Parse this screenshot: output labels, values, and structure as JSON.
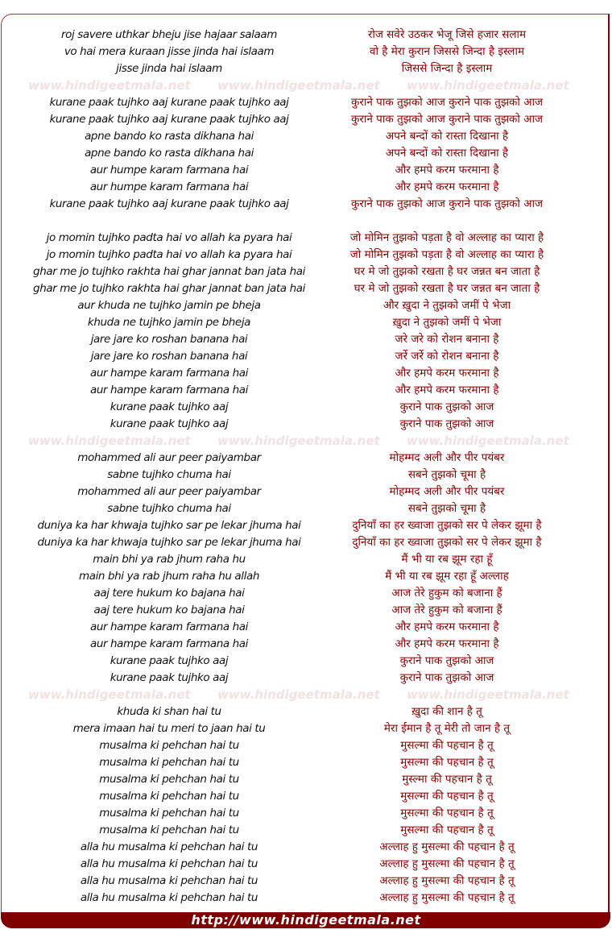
{
  "watermark": "www.hindigeetmala.net",
  "footer_link": "http://www.hindigeetmala.net",
  "colors": {
    "accent": "#800000",
    "hindi_text": "#8b0000",
    "watermark": "#f1e1e1"
  },
  "rows": [
    {
      "en": "roj savere uthkar bheju jise hajaar salaam",
      "hi": "रोज सवेरे उठकर भेजू जिसे हजार सलाम"
    },
    {
      "en": "vo hai mera kuraan jisse jinda hai islaam",
      "hi": "वो है मेरा कुरान जिससे जिन्दा है इस्लाम"
    },
    {
      "en": "jisse jinda hai islaam",
      "hi": "जिससे जिन्दा है इस्लाम"
    },
    {
      "wm": true
    },
    {
      "en": "kurane paak tujhko aaj kurane paak tujhko aaj",
      "hi": "कुराने पाक तुझको आज कुराने पाक तुझको आज"
    },
    {
      "en": "kurane paak tujhko aaj kurane paak tujhko aaj",
      "hi": "कुराने पाक तुझको आज कुराने पाक तुझको आज"
    },
    {
      "en": "apne bando ko rasta dikhana hai",
      "hi": "अपने बन्दों को रास्ता दिखाना है"
    },
    {
      "en": "apne bando ko rasta dikhana hai",
      "hi": "अपने बन्दों को रास्ता दिखाना है"
    },
    {
      "en": "aur humpe karam farmana hai",
      "hi": "और हमपे करम फरमाना है"
    },
    {
      "en": "aur humpe karam farmana hai",
      "hi": "और हमपे करम फरमाना है"
    },
    {
      "en": "kurane paak tujhko aaj kurane paak tujhko aaj",
      "hi": "कुराने पाक तुझको आज कुराने पाक तुझको आज"
    },
    {
      "blank": true
    },
    {
      "en": "jo momin tujhko padta hai vo allah ka pyara hai",
      "hi": "जो मोमिन तुझको पड़ता है वो अल्लाह का प्यारा है"
    },
    {
      "en": "jo momin tujhko padta hai vo allah ka pyara hai",
      "hi": "जो मोमिन तुझको पड़ता है वो अल्लाह का प्यारा है"
    },
    {
      "en": "ghar me jo tujhko rakhta hai ghar jannat ban jata hai",
      "hi": "घर मे जो तुझको रखता है घर जन्नत बन जाता है"
    },
    {
      "en": "ghar me jo tujhko rakhta hai ghar jannat ban jata hai",
      "hi": "घर मे जो तुझको रखता है घर जन्नत बन जाता है"
    },
    {
      "en": "aur khuda ne tujhko jamin pe bheja",
      "hi": "और ख़ुदा ने तुझको जमीं पे भेजा"
    },
    {
      "en": "khuda ne tujhko jamin pe bheja",
      "hi": "ख़ुदा ने तुझको जमीं पे भेजा"
    },
    {
      "en": "jare jare ko roshan banana hai",
      "hi": "जरे जरे को रोशन बनाना है"
    },
    {
      "en": "jare jare ko roshan banana hai",
      "hi": "जर्रे जर्रे को रोशन बनाना है"
    },
    {
      "en": "aur hampe karam farmana hai",
      "hi": "और हमपे करम फरमाना है"
    },
    {
      "en": "aur hampe karam farmana hai",
      "hi": "और हमपे करम फरमाना है"
    },
    {
      "en": "kurane paak tujhko aaj",
      "hi": "कुराने पाक तुझको आज"
    },
    {
      "en": "kurane paak tujhko aaj",
      "hi": "कुराने पाक तुझको आज"
    },
    {
      "wm": true
    },
    {
      "en": "mohammed ali aur peer paiyambar",
      "hi": "मोहम्मद अली और पीर पयंबर"
    },
    {
      "en": "sabne tujhko chuma hai",
      "hi": "सबने तुझको चूमा है"
    },
    {
      "en": "mohammed ali aur peer paiyambar",
      "hi": "मोहम्मद अली और पीर पयंबर"
    },
    {
      "en": "sabne tujhko chuma hai",
      "hi": "सबने तुझको चूमा है"
    },
    {
      "en": "duniya ka har khwaja tujhko sar pe lekar jhuma hai",
      "hi": "दुनियाँ का हर ख्वाजा तुझको सर पे लेकर झूमा है"
    },
    {
      "en": "duniya ka har khwaja tujhko sar pe lekar jhuma hai",
      "hi": "दुनियाँ का हर ख्वाजा तुझको सर पे लेकर झूमा है"
    },
    {
      "en": "main bhi ya rab jhum raha hu",
      "hi": "मैं भी या रब झूम रहा हूँ"
    },
    {
      "en": "main bhi ya rab jhum raha hu allah",
      "hi": "मैं भी या रब झूम रहा हूँ अल्लाह"
    },
    {
      "en": "aaj tere hukum ko bajana hai",
      "hi": "आज तेरे हुकुम को बजाना हैं"
    },
    {
      "en": "aaj tere hukum ko bajana hai",
      "hi": "आज तेरे हुकुम को बजाना हैं"
    },
    {
      "en": "aur hampe karam farmana hai",
      "hi": "और हमपे करम फरमाना है"
    },
    {
      "en": "aur hampe karam farmana hai",
      "hi": "और हमपे करम फरमाना है"
    },
    {
      "en": "kurane paak tujhko aaj",
      "hi": "कुराने पाक तुझको आज"
    },
    {
      "en": "kurane paak tujhko aaj",
      "hi": "कुराने पाक तुझको आज"
    },
    {
      "wm": true
    },
    {
      "en": "khuda ki shan hai tu",
      "hi": "ख़ुदा की शान है तू"
    },
    {
      "en": "mera imaan hai tu meri to jaan hai tu",
      "hi": "मेरा ईमान है तू मेरी तो जान है तू"
    },
    {
      "en": "musalma ki pehchan hai tu",
      "hi": "मुसल्मा की पहचान है तू"
    },
    {
      "en": "musalma ki pehchan hai tu",
      "hi": "मुसल्मा की पहचान है तू"
    },
    {
      "en": "musalma ki pehchan hai tu",
      "hi": "मुस्ल्मा की पहचान है तू"
    },
    {
      "en": "musalma ki pehchan hai tu",
      "hi": "मुसल्मा की पहचान है तू"
    },
    {
      "en": "musalma ki pehchan hai tu",
      "hi": "मुसल्मा की पहचान है तू"
    },
    {
      "en": "musalma ki pehchan hai tu",
      "hi": "मुसल्मा की पहचान है तू"
    },
    {
      "en": "alla hu musalma ki pehchan hai tu",
      "hi": "अल्लाह हु मुसल्मा की पहचान है तू"
    },
    {
      "en": "alla hu musalma ki pehchan hai tu",
      "hi": "अल्लाह हु मुसल्मा की पहचान है तू"
    },
    {
      "en": "alla hu musalma ki pehchan hai tu",
      "hi": "अल्लाह हु मुसल्मा की पहचान है तू"
    },
    {
      "en": "alla hu musalma ki pehchan hai tu",
      "hi": "अल्लाह हु मुसल्मा की पहचान है तू"
    }
  ]
}
